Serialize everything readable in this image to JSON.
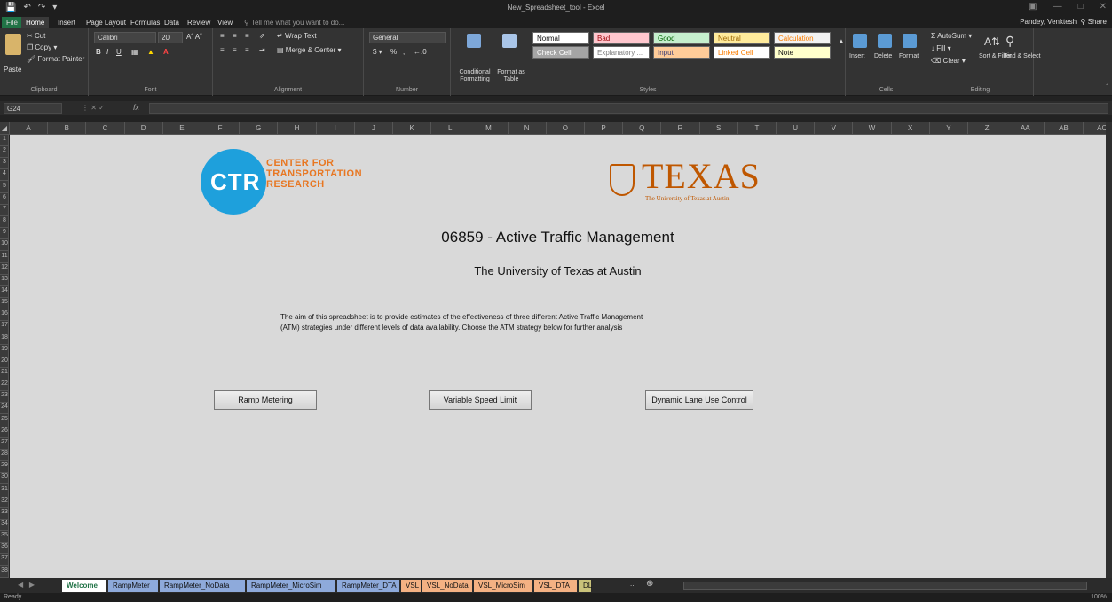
{
  "window": {
    "title": "New_Spreadsheet_tool - Excel",
    "user": "Pandey, Venktesh",
    "share_label": "Share"
  },
  "menu": {
    "tabs": [
      "File",
      "Home",
      "Insert",
      "Page Layout",
      "Formulas",
      "Data",
      "Review",
      "View"
    ],
    "tell_me": "Tell me what you want to do..."
  },
  "ribbon": {
    "clipboard": {
      "label": "Clipboard",
      "paste": "Paste",
      "cut": "Cut",
      "copy": "Copy",
      "format_painter": "Format Painter"
    },
    "font": {
      "label": "Font",
      "name": "Calibri",
      "size": "20"
    },
    "alignment": {
      "label": "Alignment",
      "wrap": "Wrap Text",
      "merge": "Merge & Center"
    },
    "number": {
      "label": "Number",
      "format": "General"
    },
    "styles": {
      "label": "Styles",
      "conditional": "Conditional Formatting",
      "format_as_table": "Format as Table",
      "cells": [
        {
          "name": "Normal",
          "bg": "#ffffff",
          "fg": "#111111"
        },
        {
          "name": "Bad",
          "bg": "#ffc7ce",
          "fg": "#9c0006"
        },
        {
          "name": "Good",
          "bg": "#c6efce",
          "fg": "#006100"
        },
        {
          "name": "Neutral",
          "bg": "#ffeb9c",
          "fg": "#9c6500"
        },
        {
          "name": "Calculation",
          "bg": "#f2f2f2",
          "fg": "#fa7d00"
        },
        {
          "name": "Check Cell",
          "bg": "#a5a5a5",
          "fg": "#ffffff"
        },
        {
          "name": "Explanatory ...",
          "bg": "#ffffff",
          "fg": "#7f7f7f"
        },
        {
          "name": "Input",
          "bg": "#ffcc99",
          "fg": "#3f3f76"
        },
        {
          "name": "Linked Cell",
          "bg": "#ffffff",
          "fg": "#fa7d00"
        },
        {
          "name": "Note",
          "bg": "#ffffcc",
          "fg": "#111111"
        }
      ]
    },
    "cells_group": {
      "label": "Cells",
      "insert": "Insert",
      "delete": "Delete",
      "format": "Format"
    },
    "editing": {
      "label": "Editing",
      "autosum": "AutoSum",
      "fill": "Fill",
      "clear": "Clear",
      "sort_filter": "Sort & Filter",
      "find_select": "Find & Select"
    }
  },
  "formula_bar": {
    "name_box": "G24",
    "fx": "fx"
  },
  "columns": [
    "A",
    "B",
    "C",
    "D",
    "E",
    "F",
    "G",
    "H",
    "I",
    "J",
    "K",
    "L",
    "M",
    "N",
    "O",
    "P",
    "Q",
    "R",
    "S",
    "T",
    "U",
    "V",
    "W",
    "X",
    "Y",
    "Z",
    "AA",
    "AB",
    "AC"
  ],
  "rows": [
    "1",
    "2",
    "3",
    "4",
    "5",
    "6",
    "7",
    "8",
    "9",
    "10",
    "11",
    "12",
    "13",
    "14",
    "15",
    "16",
    "17",
    "18",
    "19",
    "20",
    "21",
    "22",
    "23",
    "24",
    "25",
    "26",
    "27",
    "28",
    "29",
    "30",
    "31",
    "32",
    "33",
    "34",
    "35",
    "36",
    "37",
    "38"
  ],
  "content": {
    "ctr_logo_letters": "CTR",
    "ctr_text": [
      "CENTER FOR",
      "TRANSPORTATION",
      "RESEARCH"
    ],
    "texas_word": "TEXAS",
    "texas_sub": "The University of Texas at Austin",
    "title": "06859 - Active Traffic Management",
    "subtitle": "The University of Texas at Austin",
    "description": "The aim of this spreadsheet is to provide estimates of the effectiveness of three different Active Traffic Management (ATM) strategies under different levels of data availability. Choose the ATM strategy below for further analysis",
    "buttons": {
      "ramp": "Ramp Metering",
      "vsl": "Variable Speed Limit",
      "dluc": "Dynamic Lane Use Control"
    }
  },
  "sheet_tabs": [
    {
      "name": "Welcome",
      "color": "#ffffff",
      "active": true
    },
    {
      "name": "RampMeter",
      "color": "#8eaadb"
    },
    {
      "name": "RampMeter_NoData",
      "color": "#8eaadb"
    },
    {
      "name": "RampMeter_MicroSim",
      "color": "#8eaadb"
    },
    {
      "name": "RampMeter_DTA",
      "color": "#8eaadb"
    },
    {
      "name": "VSL",
      "color": "#f4b183"
    },
    {
      "name": "VSL_NoData",
      "color": "#f4b183"
    },
    {
      "name": "VSL_MicroSim",
      "color": "#f4b183"
    },
    {
      "name": "VSL_DTA",
      "color": "#f4b183"
    },
    {
      "name": "DL",
      "color": "#c9c27a"
    }
  ],
  "status": {
    "ready": "Ready",
    "zoom": "100%"
  }
}
